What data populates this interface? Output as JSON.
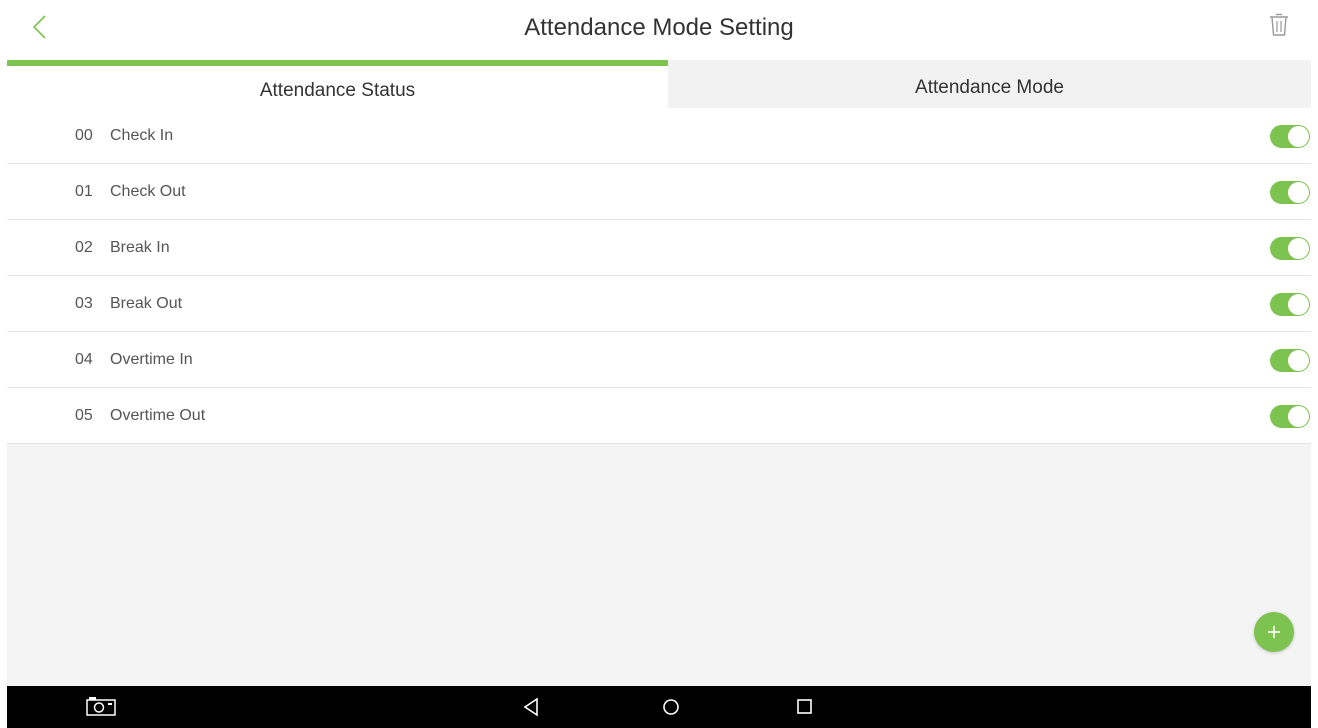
{
  "colors": {
    "accent": "#7cc44f",
    "background": "#ffffff",
    "inactive_tab": "#f2f2f2",
    "empty_area": "#f4f4f4",
    "navbar": "#000000"
  },
  "header": {
    "title": "Attendance Mode Setting",
    "back_icon": "chevron-left-icon",
    "delete_icon": "trash-icon"
  },
  "tabs": [
    {
      "label": "Attendance Status",
      "active": true
    },
    {
      "label": "Attendance Mode",
      "active": false
    }
  ],
  "statuses": [
    {
      "code": "00",
      "label": "Check In",
      "enabled": true
    },
    {
      "code": "01",
      "label": "Check Out",
      "enabled": true
    },
    {
      "code": "02",
      "label": "Break In",
      "enabled": true
    },
    {
      "code": "03",
      "label": "Break Out",
      "enabled": true
    },
    {
      "code": "04",
      "label": "Overtime In",
      "enabled": true
    },
    {
      "code": "05",
      "label": "Overtime Out",
      "enabled": true
    }
  ],
  "fab": {
    "icon": "plus-icon"
  },
  "navbar": {
    "icons": [
      "screenshot-icon",
      "back-triangle-icon",
      "home-circle-icon",
      "recents-square-icon"
    ]
  }
}
